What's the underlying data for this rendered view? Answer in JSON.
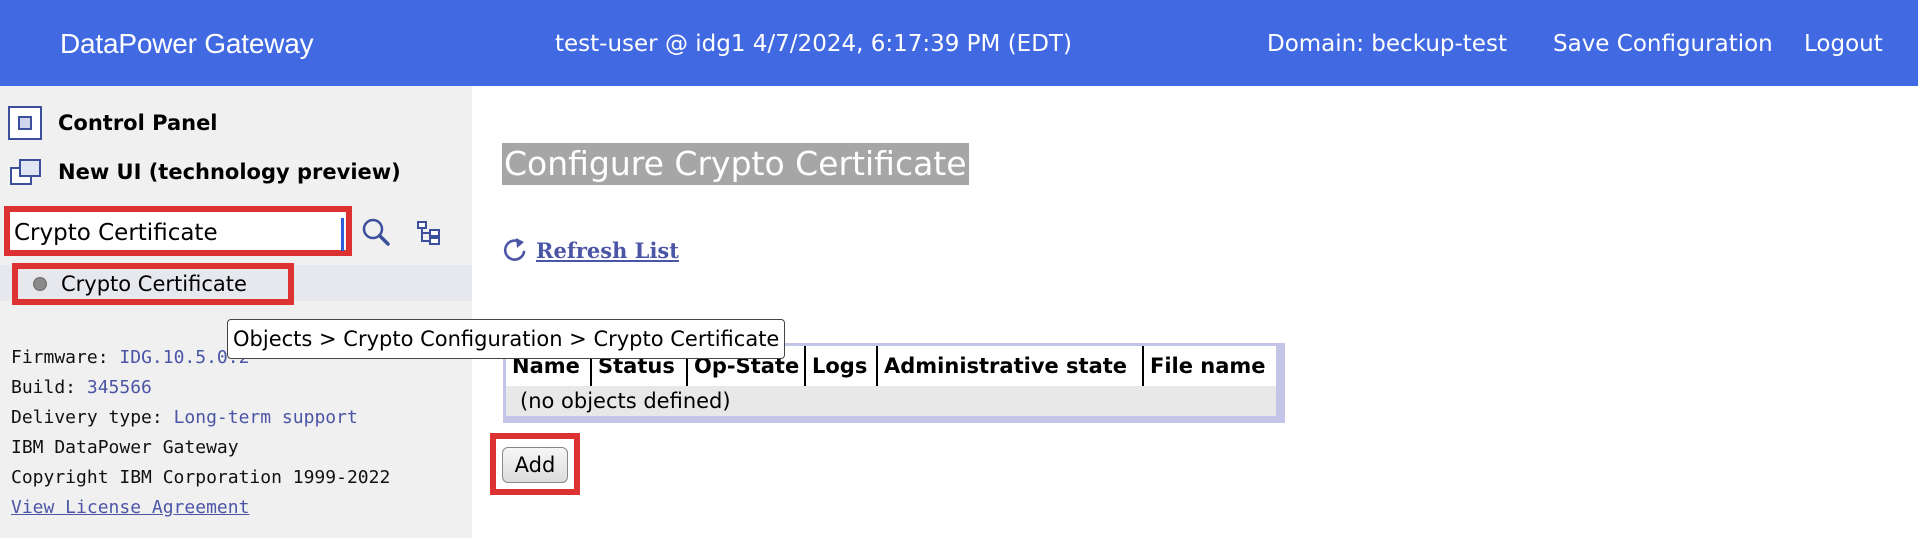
{
  "header": {
    "brand": "DataPower Gateway",
    "session": "test-user @ idg1 4/7/2024, 6:17:39 PM (EDT)",
    "domain": "Domain: beckup-test",
    "save_configuration": "Save Configuration",
    "logout": "Logout",
    "background_color": "#4169e1"
  },
  "sidebar": {
    "control_panel": "Control Panel",
    "new_ui": "New UI (technology preview)",
    "search": {
      "value": "Crypto Certificate",
      "search_icon": "search-icon",
      "tree_icon": "tree-view-icon"
    },
    "results": [
      {
        "label": "Crypto Certificate"
      }
    ],
    "info": {
      "firmware_label": "Firmware:",
      "firmware_value": "IDG.10.5.0.2",
      "build_label": "Build:",
      "build_value": "345566",
      "delivery_label": "Delivery type:",
      "delivery_value": "Long-term support",
      "product": "IBM DataPower Gateway",
      "copyright": "Copyright IBM Corporation 1999-2022",
      "license_link": "View License Agreement"
    }
  },
  "main": {
    "title": "Configure Crypto Certificate",
    "refresh": "Refresh List",
    "tooltip": "Objects > Crypto Configuration > Crypto Certificate",
    "table": {
      "columns": [
        "Name",
        "Status",
        "Op-State",
        "Logs",
        "Administrative state",
        "File name"
      ],
      "empty": "(no objects defined)"
    },
    "add_button": "Add"
  },
  "colors": {
    "highlight_border": "#dc3232",
    "link": "#4b55a6",
    "title_background": "#a6a6a6"
  }
}
